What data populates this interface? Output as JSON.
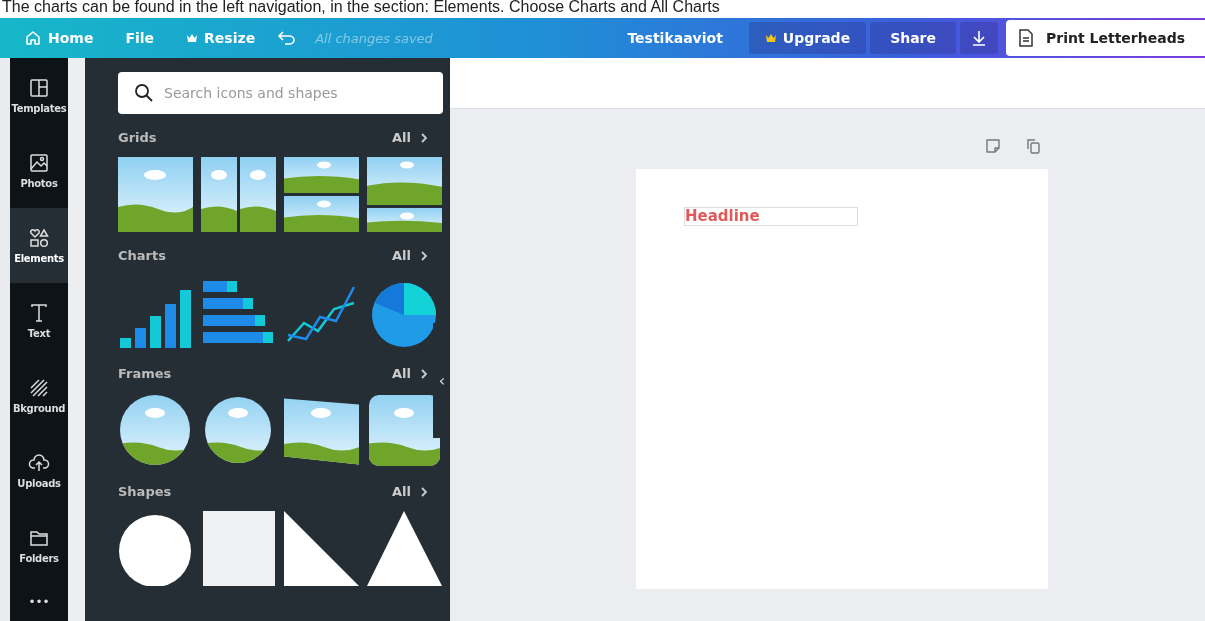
{
  "caption": "The charts can be found in the left navigation, in the section: Elements. Choose Charts and All Charts",
  "topbar": {
    "home": "Home",
    "file": "File",
    "resize": "Resize",
    "save_status": "All changes saved",
    "title": "Testikaaviot",
    "upgrade": "Upgrade",
    "share": "Share",
    "print": "Print Letterheads"
  },
  "sidebar": {
    "items": [
      {
        "label": "Templates",
        "kind": "templates",
        "selected": false
      },
      {
        "label": "Photos",
        "kind": "photos",
        "selected": false
      },
      {
        "label": "Elements",
        "kind": "elements",
        "selected": true
      },
      {
        "label": "Text",
        "kind": "text",
        "selected": false
      },
      {
        "label": "Bkground",
        "kind": "background",
        "selected": false
      },
      {
        "label": "Uploads",
        "kind": "uploads",
        "selected": false
      },
      {
        "label": "Folders",
        "kind": "folders",
        "selected": false
      }
    ],
    "more": "•••"
  },
  "panel": {
    "search": {
      "placeholder": "Search icons and shapes"
    },
    "collapse": "‹",
    "sections": [
      {
        "title": "Grids",
        "link": "All",
        "items": [
          {
            "kind": "grid1"
          },
          {
            "kind": "grid2"
          },
          {
            "kind": "grid3"
          },
          {
            "kind": "grid4"
          }
        ]
      },
      {
        "title": "Charts",
        "link": "All",
        "items": [
          {
            "kind": "bars"
          },
          {
            "kind": "hbars"
          },
          {
            "kind": "lines"
          },
          {
            "kind": "pie"
          }
        ]
      },
      {
        "title": "Frames",
        "link": "All",
        "items": [
          {
            "kind": "circle-frame"
          },
          {
            "kind": "badge-frame"
          },
          {
            "kind": "slant-frame"
          },
          {
            "kind": "rounded-frame"
          }
        ]
      },
      {
        "title": "Shapes",
        "link": "All",
        "items": [
          {
            "kind": "circle"
          },
          {
            "kind": "square"
          },
          {
            "kind": "right-triangle"
          },
          {
            "kind": "triangle"
          }
        ]
      }
    ]
  },
  "page": {
    "headline": "Headline"
  }
}
